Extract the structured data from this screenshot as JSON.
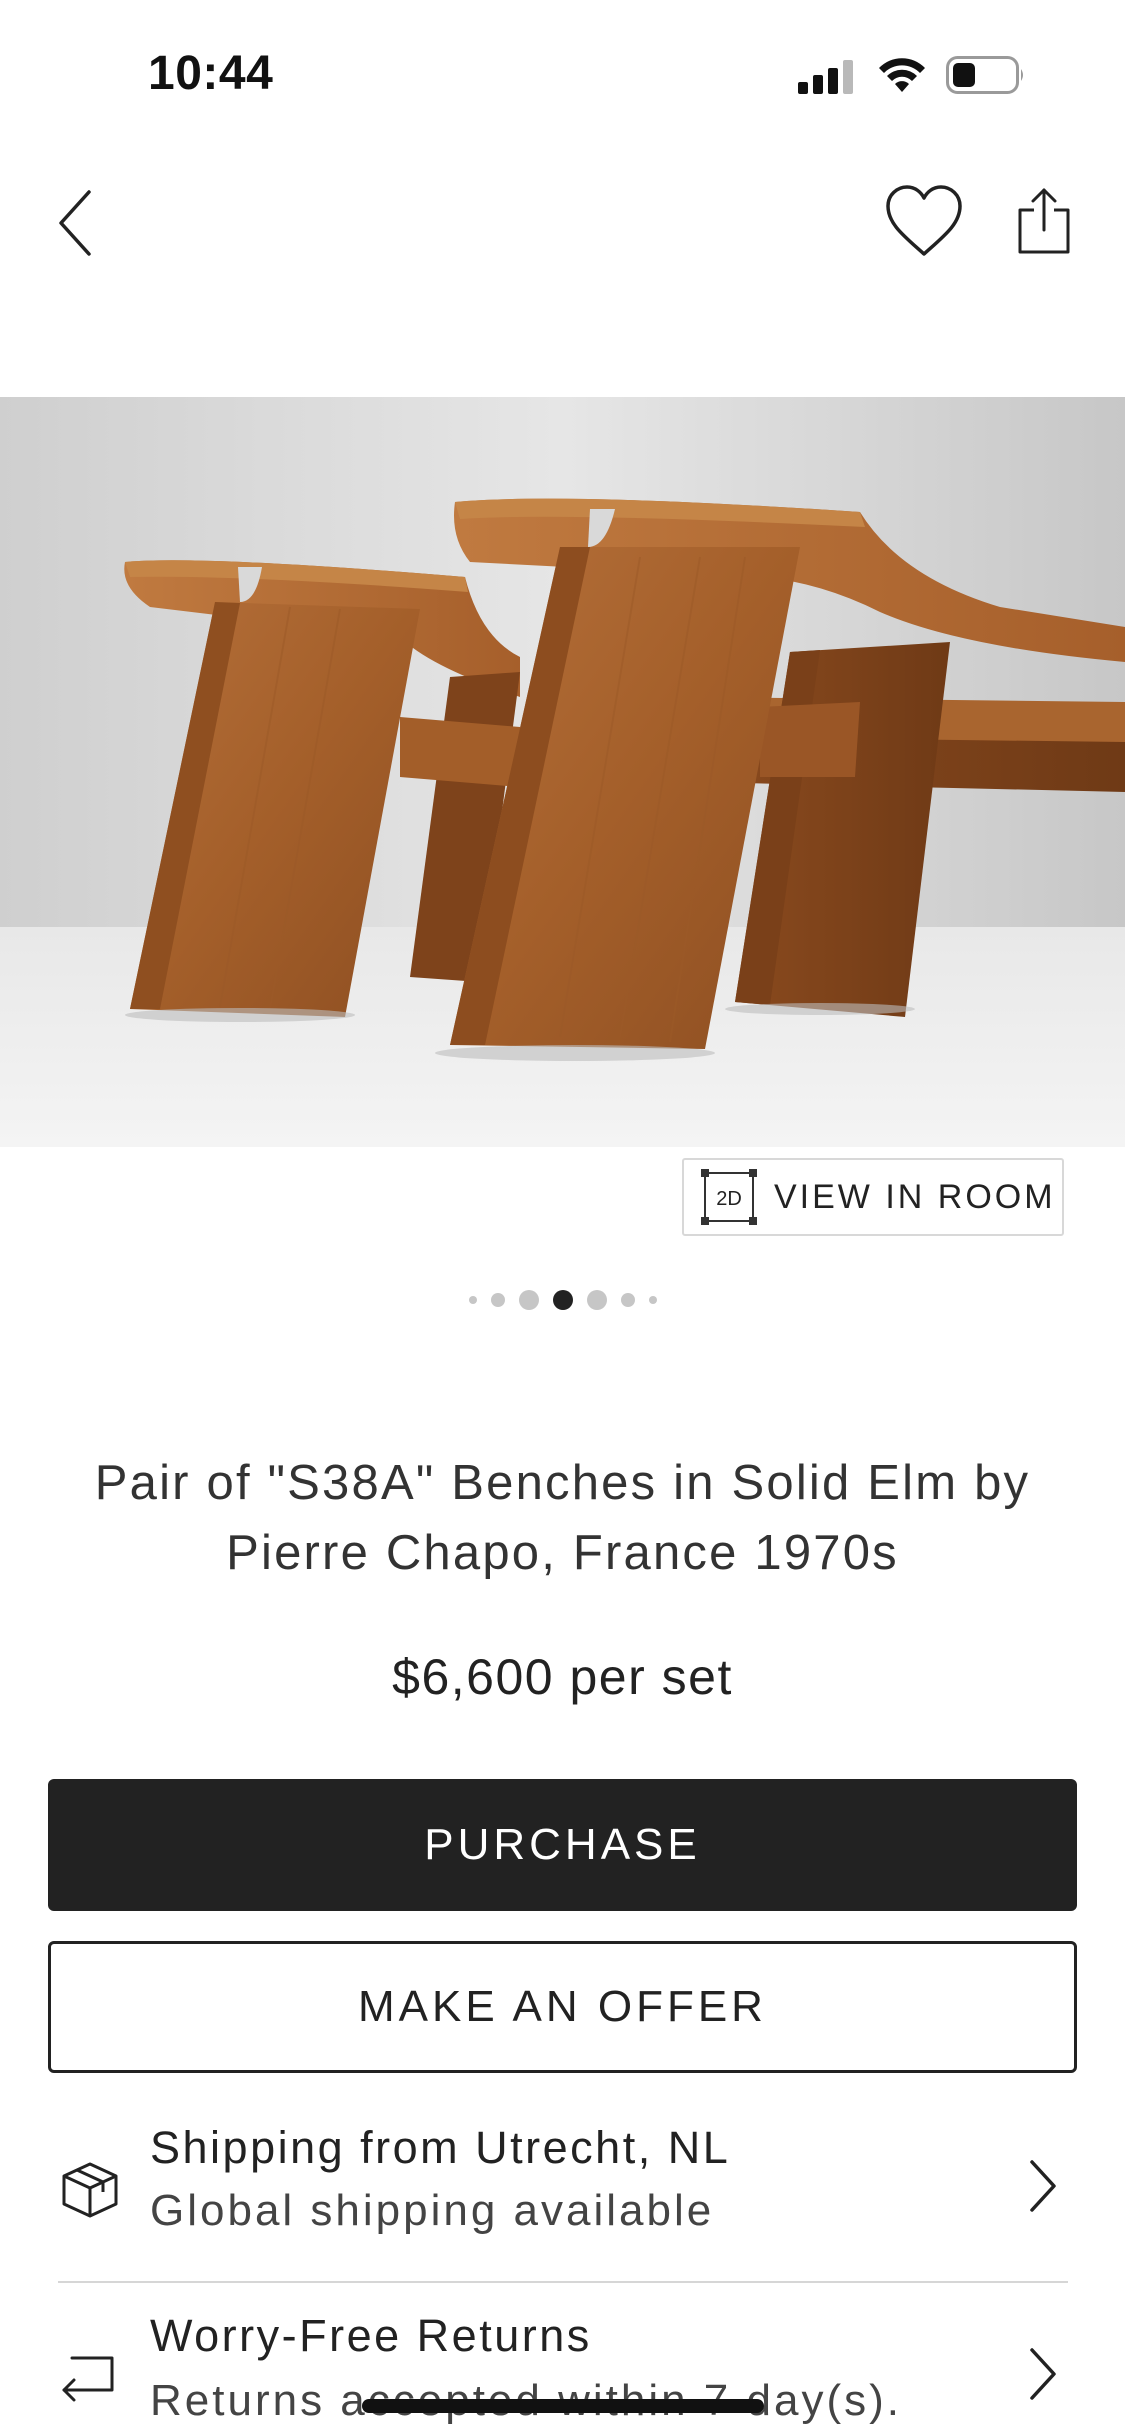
{
  "status_bar": {
    "time": "10:44",
    "icons": [
      "cellular-signal-icon",
      "wifi-icon",
      "battery-icon"
    ]
  },
  "nav_bar": {
    "back_icon": "chevron-left-icon",
    "favorite_icon": "heart-icon",
    "share_icon": "share-icon"
  },
  "gallery": {
    "image_alt": "Pair of solid elm benches photographed on a grey studio background",
    "view_in_room_badge": "2D",
    "view_in_room_label": "VIEW IN ROOM",
    "page_count": 7,
    "active_index": 3
  },
  "product": {
    "title": "Pair of \"S38A\" Benches in Solid Elm by Pierre Chapo, France 1970s",
    "price": "$6,600 per set"
  },
  "actions": {
    "purchase_label": "PURCHASE",
    "offer_label": "MAKE AN OFFER"
  },
  "info_rows": [
    {
      "icon": "package-icon",
      "title": "Shipping from Utrecht, NL",
      "subtitle": "Global shipping available"
    },
    {
      "icon": "return-arrow-icon",
      "title": "Worry-Free Returns",
      "subtitle": "Returns accepted within 7 day(s)."
    }
  ],
  "colors": {
    "primary_button": "#222222",
    "text": "#222222",
    "divider": "#d6d6d6",
    "dot_inactive": "#c6c6c6",
    "wood": "#b06a2e"
  }
}
